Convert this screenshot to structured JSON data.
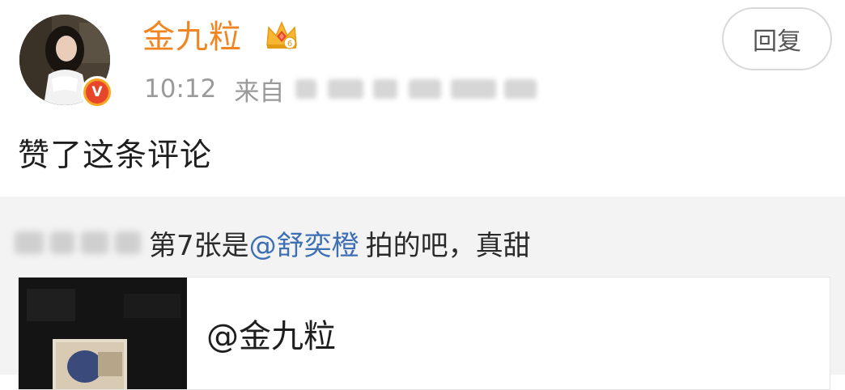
{
  "post": {
    "username": "金九粒",
    "time": "10:12",
    "from_label": "来自",
    "text": "赞了这条评论",
    "reply_button": "回复"
  },
  "icons": {
    "verified": "verified-v-badge-icon",
    "membership": "crown-level-icon",
    "verified_letter": "V",
    "membership_level": "6"
  },
  "colors": {
    "username": "#f18522",
    "mention": "#3d6fb5",
    "meta": "#9a9a9a",
    "quoted_background": "#f3f3f3",
    "verified_badge": "#f6a623"
  },
  "quoted_comment": {
    "text_prefix": "第7张是",
    "mention": "@舒奕橙",
    "text_suffix": "拍的吧，真甜"
  },
  "card": {
    "title": "@金九粒"
  }
}
